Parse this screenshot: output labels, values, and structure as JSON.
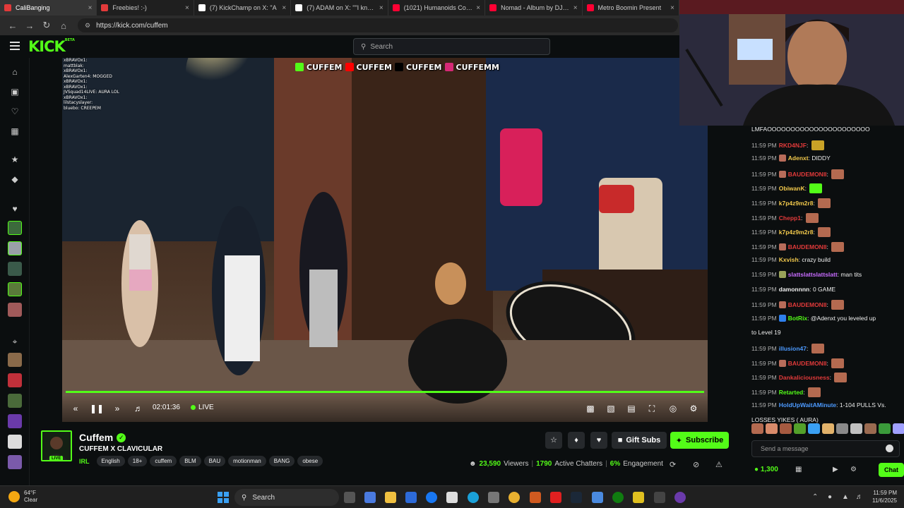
{
  "browser": {
    "tabs": [
      {
        "label": "CaliBanging",
        "color": "#e23a3a",
        "active": true
      },
      {
        "label": "Freebies! :-)",
        "color": "#e23a3a",
        "active": false
      },
      {
        "label": "(7) KickChamp on X: \"A",
        "color": "#ffffff",
        "active": false
      },
      {
        "label": "(7) ADAM on X: \"\"I knew pe",
        "color": "#ffffff",
        "active": false
      },
      {
        "label": "(1021) Humanoids Cost as F",
        "color": "#ff0033",
        "active": false
      },
      {
        "label": "Nomad - Album by DJ Snak",
        "color": "#ff0033",
        "active": false
      },
      {
        "label": "Metro Boomin Present",
        "color": "#ff0033",
        "active": false
      }
    ],
    "url": "https://kick.com/cuffem"
  },
  "header": {
    "logo": "KICK",
    "logo_sup": "BETA",
    "search_placeholder": "Search"
  },
  "video": {
    "overlay_chat": [
      "xBRAVOx1:",
      "mattblak:",
      "xBRAVOx1:",
      "AlexGarten4: MOGGED",
      "xBRAVOx1:",
      "xBRAVOx1:",
      "JVSquad14LIVE: AURA LOL",
      "xBRAVOx1:",
      "lilstacyslayer:",
      "bluebo: CREEPEM"
    ],
    "socials": [
      "CUFFEM",
      "CUFFEM",
      "CUFFEM",
      "CUFFEMM"
    ],
    "socials_colors": [
      "#53fc18",
      "#ff0000",
      "#000000",
      "#d62976"
    ],
    "time": "02:01:36",
    "live_label": "LIVE",
    "progress_fraction": 1.0
  },
  "chat": {
    "first_line": "LMFAOOOOOOOOOOOOOOOOOOOOOO",
    "messages": [
      {
        "ts": "11:59 PM",
        "user": "RKD4NJF",
        "color": "#e23a3a",
        "msg": "",
        "badge": "",
        "emote": "#c9a227"
      },
      {
        "ts": "11:59 PM",
        "user": "Adenxt",
        "color": "#f2c94c",
        "msg": "DIDDY",
        "badge": "#b86c5a",
        "emote": ""
      },
      {
        "ts": "11:59 PM",
        "user": "BAUDEMONII",
        "color": "#e23a3a",
        "msg": "",
        "badge": "#b86c5a",
        "emote": "#b46a50"
      },
      {
        "ts": "11:59 PM",
        "user": "ObiwanK",
        "color": "#f2c94c",
        "msg": "",
        "badge": "",
        "emote": "#53fc18"
      },
      {
        "ts": "11:59 PM",
        "user": "k7p4z9m2r8",
        "color": "#f2c94c",
        "msg": "",
        "badge": "",
        "emote": "#b46a50"
      },
      {
        "ts": "11:59 PM",
        "user": "Chepp1",
        "color": "#e23a3a",
        "msg": "",
        "badge": "",
        "emote": "#b46a50"
      },
      {
        "ts": "11:59 PM",
        "user": "k7p4z9m2r8",
        "color": "#f2c94c",
        "msg": "",
        "badge": "",
        "emote": "#b46a50"
      },
      {
        "ts": "11:59 PM",
        "user": "BAUDEMONII",
        "color": "#e23a3a",
        "msg": "",
        "badge": "#b86c5a",
        "emote": "#b46a50"
      },
      {
        "ts": "11:59 PM",
        "user": "Kxvish",
        "color": "#f2c94c",
        "msg": "crazy build",
        "badge": "",
        "emote": ""
      },
      {
        "ts": "11:59 PM",
        "user": "slattslattslattslatt",
        "color": "#c86cff",
        "msg": "man tits",
        "badge": "#9aa35a",
        "emote": ""
      },
      {
        "ts": "11:59 PM",
        "user": "damonnnn",
        "color": "#eeeeee",
        "msg": "0 GAME",
        "badge": "",
        "emote": ""
      },
      {
        "ts": "11:59 PM",
        "user": "BAUDEMONII",
        "color": "#e23a3a",
        "msg": "",
        "badge": "#b86c5a",
        "emote": "#b46a50"
      },
      {
        "ts": "11:59 PM",
        "user": "BotRix",
        "color": "#53fc18",
        "msg": "@Adenxt you leveled up",
        "badge": "#2f80ed",
        "emote": ""
      },
      {
        "ts": "",
        "user": "",
        "color": "#eeeeee",
        "msg": "to Level 19",
        "badge": "",
        "emote": ""
      },
      {
        "ts": "11:59 PM",
        "user": "illusion47",
        "color": "#4c9aff",
        "msg": "",
        "badge": "",
        "emote": "#b46a50"
      },
      {
        "ts": "11:59 PM",
        "user": "BAUDEMONII",
        "color": "#e23a3a",
        "msg": "",
        "badge": "#b86c5a",
        "emote": "#b46a50"
      },
      {
        "ts": "11:59 PM",
        "user": "Dankaliciousness",
        "color": "#e23a3a",
        "msg": "",
        "badge": "",
        "emote": "#b46a50"
      },
      {
        "ts": "11:59 PM",
        "user": "Retarted",
        "color": "#53fc18",
        "msg": "",
        "badge": "",
        "emote": "#b46a50"
      },
      {
        "ts": "11:59 PM",
        "user": "HoldUpWaitAMinute",
        "color": "#4c9aff",
        "msg": "1-104 PULLS Vs.",
        "badge": "",
        "emote": ""
      },
      {
        "ts": "",
        "user": "",
        "color": "#eeeeee",
        "msg": "LOSSES     YIKES (     AURA)",
        "badge": "",
        "emote": ""
      }
    ],
    "emote_bar_colors": [
      "#b46a50",
      "#d88a6a",
      "#a65a40",
      "#53a02a",
      "#3aa0f3",
      "#e2b26a",
      "#8a8a8a",
      "#c0c0c0",
      "#9a6a50",
      "#3a9a3a",
      "#a0a0ff"
    ],
    "send_placeholder": "Send a message",
    "points": "1,300",
    "chat_button": "Chat"
  },
  "channel": {
    "name": "Cuffem",
    "title": "CUFFEM X CLAVICULAR",
    "live_badge": "LIVE",
    "category": "IRL",
    "tags": [
      "English",
      "18+",
      "cuffem",
      "BLM",
      "BAU",
      "motionman",
      "BANG",
      "obese"
    ],
    "gift_label": "Gift Subs",
    "subscribe_label": "Subscribe",
    "viewers": "23,590",
    "viewers_label": "Viewers",
    "chatters": "1790",
    "chatters_label": "Active Chatters",
    "engagement": "6%",
    "engagement_label": "Engagement"
  },
  "taskbar": {
    "temp": "64°F",
    "condition": "Clear",
    "search_label": "Search",
    "time": "11:59 PM",
    "date": "11/6/2025"
  }
}
